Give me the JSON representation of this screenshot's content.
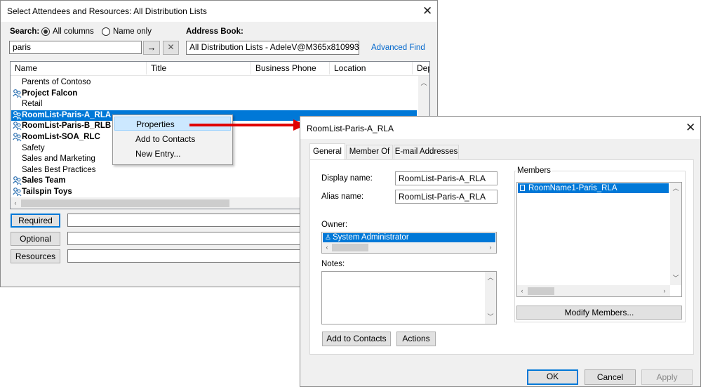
{
  "main_dialog": {
    "title": "Select Attendees and Resources: All Distribution Lists",
    "search_label": "Search:",
    "radio_all_columns": "All columns",
    "radio_name_only": "Name only",
    "address_book_label": "Address Book:",
    "search_value": "paris",
    "go_icon": "→",
    "clear_icon": "✕",
    "address_book_value": "All Distribution Lists - AdeleV@M365x810993",
    "advanced_find": "Advanced Find",
    "columns": [
      "Name",
      "Title",
      "Business Phone",
      "Location",
      "Dep"
    ],
    "rows": [
      {
        "name": "Parents of Contoso",
        "bold": false,
        "icon": false,
        "selected": false
      },
      {
        "name": "Project Falcon",
        "bold": true,
        "icon": true,
        "selected": false
      },
      {
        "name": "Retail",
        "bold": false,
        "icon": false,
        "selected": false
      },
      {
        "name": "RoomList-Paris-A_RLA",
        "bold": true,
        "icon": true,
        "selected": true
      },
      {
        "name": "RoomList-Paris-B_RLB",
        "bold": true,
        "icon": true,
        "selected": false
      },
      {
        "name": "RoomList-SOA_RLC",
        "bold": true,
        "icon": true,
        "selected": false
      },
      {
        "name": "Safety",
        "bold": false,
        "icon": false,
        "selected": false
      },
      {
        "name": "Sales and Marketing",
        "bold": false,
        "icon": false,
        "selected": false
      },
      {
        "name": "Sales Best Practices",
        "bold": false,
        "icon": false,
        "selected": false
      },
      {
        "name": "Sales Team",
        "bold": true,
        "icon": true,
        "selected": false
      },
      {
        "name": "Tailspin Toys",
        "bold": true,
        "icon": true,
        "selected": false
      }
    ],
    "required_label": "Required",
    "optional_label": "Optional",
    "resources_label": "Resources"
  },
  "context_menu": {
    "items": [
      "Properties",
      "Add to Contacts",
      "New Entry..."
    ]
  },
  "properties_dialog": {
    "title": "RoomList-Paris-A_RLA",
    "tabs": [
      "General",
      "Member Of",
      "E-mail Addresses"
    ],
    "display_name_label": "Display name:",
    "display_name_value": "RoomList-Paris-A_RLA",
    "alias_name_label": "Alias name:",
    "alias_name_value": "RoomList-Paris-A_RLA",
    "owner_label": "Owner:",
    "owner_value": "System Administrator",
    "notes_label": "Notes:",
    "members_label": "Members",
    "members": [
      "RoomName1-Paris_RLA"
    ],
    "modify_members_label": "Modify Members...",
    "add_to_contacts_label": "Add to Contacts",
    "actions_label": "Actions",
    "ok_label": "OK",
    "cancel_label": "Cancel",
    "apply_label": "Apply"
  },
  "colors": {
    "selection": "#0078d7",
    "link": "#0066cc",
    "arrow": "#e00000"
  }
}
